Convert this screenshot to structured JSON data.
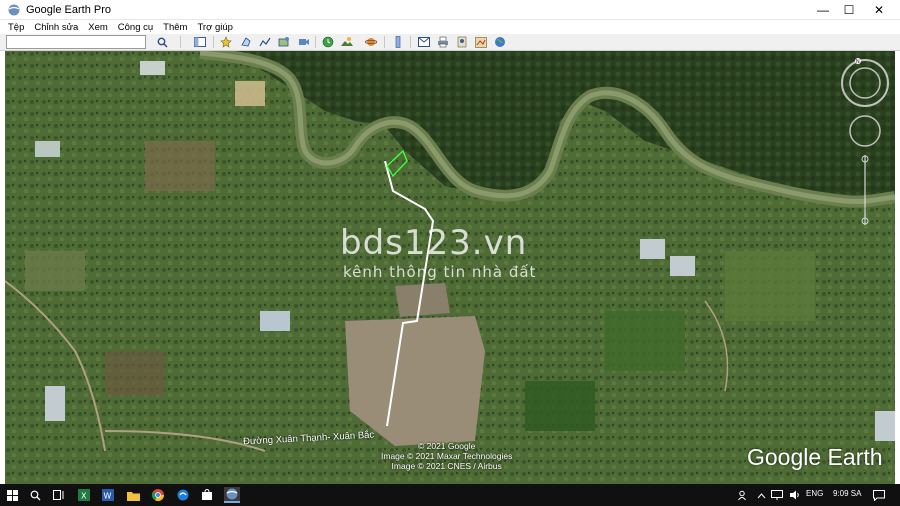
{
  "window": {
    "title": "Google Earth Pro",
    "minimize": "—",
    "maximize": "☐",
    "close": "✕"
  },
  "menu": [
    "Tệp",
    "Chỉnh sửa",
    "Xem",
    "Công cụ",
    "Thêm",
    "Trợ giúp"
  ],
  "search": {
    "value": "",
    "placeholder": ""
  },
  "map": {
    "watermark_main": "bds123.vn",
    "watermark_sub": "kênh thông tin nhà đất",
    "road_label": "Đường Xuân Thạnh- Xuân Bắc",
    "credits": [
      "© 2021 Google",
      "Image © 2021 Maxar Technologies",
      "Image © 2021 CNES / Airbus"
    ],
    "brand": "Google Earth"
  },
  "taskbar": {
    "language": "ENG",
    "time": "9:09 SA"
  }
}
